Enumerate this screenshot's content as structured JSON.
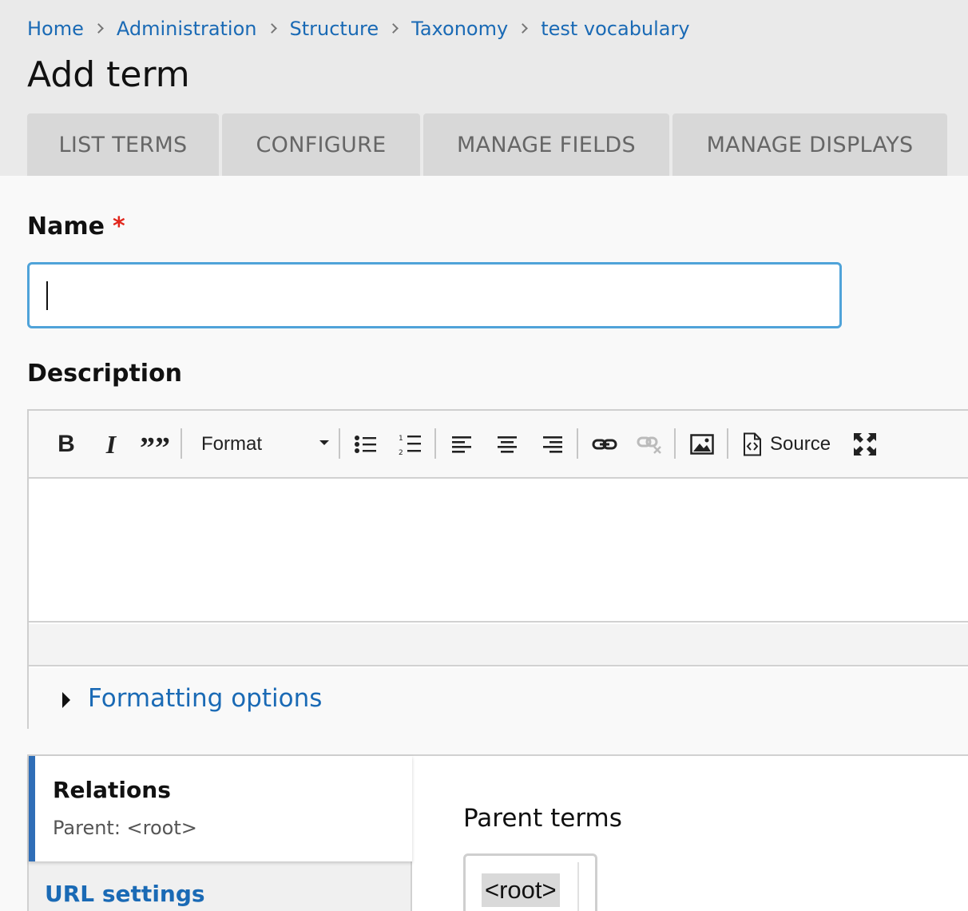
{
  "breadcrumb": [
    "Home",
    "Administration",
    "Structure",
    "Taxonomy",
    "test vocabulary"
  ],
  "page_title": "Add term",
  "tabs": [
    "LIST TERMS",
    "CONFIGURE",
    "MANAGE FIELDS",
    "MANAGE DISPLAYS"
  ],
  "name_field": {
    "label": "Name",
    "required_marker": "*",
    "value": ""
  },
  "description_field": {
    "label": "Description",
    "toolbar": {
      "bold": "B",
      "italic": "I",
      "blockquote": "””",
      "format_label": "Format",
      "source_label": "Source"
    },
    "formatting_options_label": "Formatting options"
  },
  "vertical_tabs": {
    "relations_title": "Relations",
    "relations_summary": "Parent: <root>",
    "url_settings": "URL settings"
  },
  "parent_terms": {
    "label": "Parent terms",
    "selected": "<root>"
  },
  "colors": {
    "link": "#1a6ab5",
    "required": "#e1261c",
    "focus_border": "#4fa3d9",
    "active_tab_accent": "#2f6eb7"
  }
}
